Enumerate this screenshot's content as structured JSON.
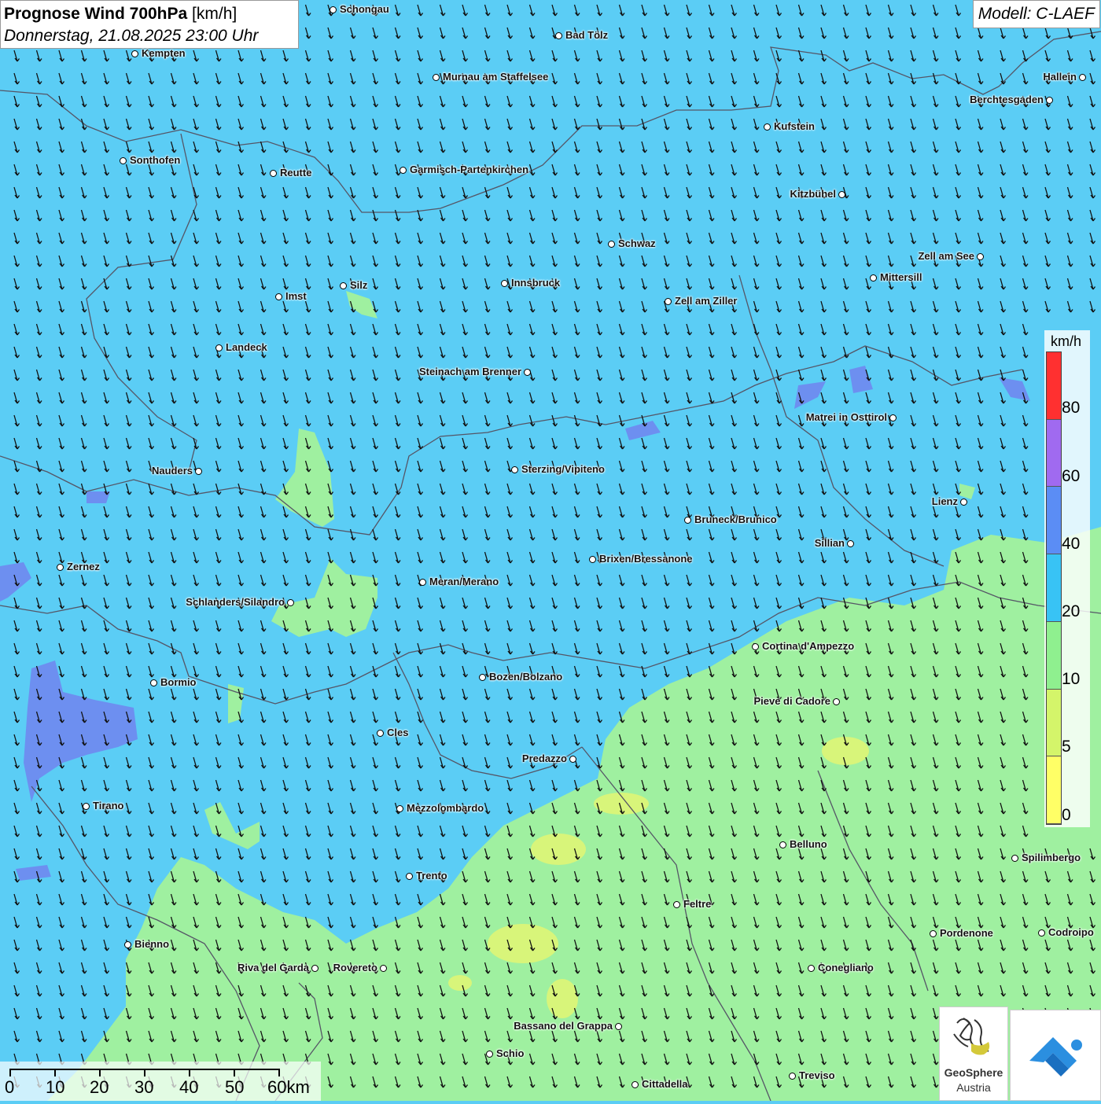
{
  "title": {
    "bold": "Prognose Wind 700hPa",
    "unit": "[km/h]",
    "datetime": "Donnerstag, 21.08.2025 23:00 Uhr"
  },
  "model": "Modell: C-LAEF",
  "legend": {
    "unit": "km/h",
    "labels": [
      "80",
      "60",
      "40",
      "20",
      "10",
      "5",
      "0"
    ],
    "colors": [
      "#ff3030",
      "#a06af0",
      "#5b8df5",
      "#38c3f5",
      "#8ff08f",
      "#d4f56a",
      "#ffff66"
    ]
  },
  "scale": {
    "labels": [
      "0",
      "10",
      "20",
      "30",
      "40",
      "50",
      "60km"
    ]
  },
  "colors": {
    "wind_20_40": "#5bcdf5",
    "wind_10_20": "#9ff0a0",
    "wind_5_10": "#d8f57a",
    "wind_40_60": "#6d8ff0",
    "border": "#555566",
    "arrow": "#111111"
  },
  "logos": {
    "geosphere_name": "GeoSphere",
    "geosphere_sub": "Austria",
    "geosphere_icon": "geosphere-logo-icon",
    "app_icon": "warn-app-logo-icon"
  },
  "cities": [
    {
      "name": "Schongau"
    },
    {
      "name": "Bad Tölz"
    },
    {
      "name": "Kempten"
    },
    {
      "name": "Murnau am Staffelsee"
    },
    {
      "name": "Hallein"
    },
    {
      "name": "Berchtesgaden"
    },
    {
      "name": "Kufstein"
    },
    {
      "name": "Sonthofen"
    },
    {
      "name": "Reutte"
    },
    {
      "name": "Garmisch-Partenkirchen"
    },
    {
      "name": "Kitzbühel"
    },
    {
      "name": "Schwaz"
    },
    {
      "name": "Zell am See"
    },
    {
      "name": "Mittersill"
    },
    {
      "name": "Silz"
    },
    {
      "name": "Innsbruck"
    },
    {
      "name": "Imst"
    },
    {
      "name": "Zell am Ziller"
    },
    {
      "name": "Landeck"
    },
    {
      "name": "Steinach am Brenner"
    },
    {
      "name": "Matrei in Osttirol"
    },
    {
      "name": "Nauders"
    },
    {
      "name": "Sterzing/Vipiteno"
    },
    {
      "name": "Lienz"
    },
    {
      "name": "Bruneck/Brunico"
    },
    {
      "name": "Sillian"
    },
    {
      "name": "Zernez"
    },
    {
      "name": "Brixen/Bressanone"
    },
    {
      "name": "Meran/Merano"
    },
    {
      "name": "Schlanders/Silandro"
    },
    {
      "name": "Cortina d'Ampezzo"
    },
    {
      "name": "Bozen/Bolzano"
    },
    {
      "name": "Bormio"
    },
    {
      "name": "Pieve di Cadore"
    },
    {
      "name": "Cles"
    },
    {
      "name": "Predazzo"
    },
    {
      "name": "Tirano"
    },
    {
      "name": "Mezzolombardo"
    },
    {
      "name": "Belluno"
    },
    {
      "name": "Spilimbergo"
    },
    {
      "name": "Trento"
    },
    {
      "name": "Feltre"
    },
    {
      "name": "Pordenone"
    },
    {
      "name": "Codroipo"
    },
    {
      "name": "Bienno"
    },
    {
      "name": "Riva del Garda"
    },
    {
      "name": "Rovereto"
    },
    {
      "name": "Conegliano"
    },
    {
      "name": "Bassano del Grappa"
    },
    {
      "name": "Schio"
    },
    {
      "name": "Treviso"
    },
    {
      "name": "Cittadella"
    }
  ]
}
